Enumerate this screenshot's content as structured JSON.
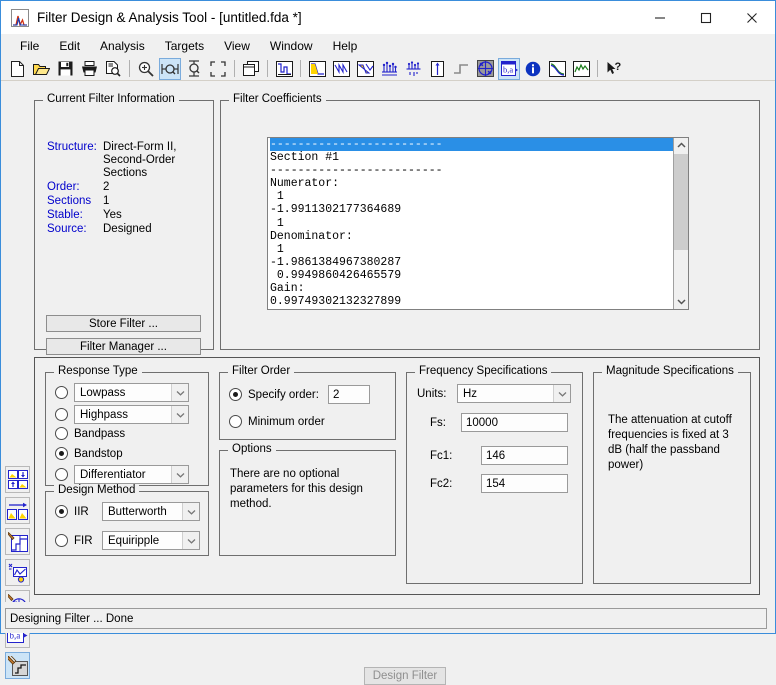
{
  "window": {
    "title": "Filter Design & Analysis Tool -  [untitled.fda *]",
    "app_icon": "filter-response-icon",
    "minimize": "minimize-icon",
    "maximize": "maximize-icon",
    "close": "close-icon"
  },
  "menu": {
    "items": [
      {
        "label": "File"
      },
      {
        "label": "Edit"
      },
      {
        "label": "Analysis"
      },
      {
        "label": "Targets"
      },
      {
        "label": "View"
      },
      {
        "label": "Window"
      },
      {
        "label": "Help"
      }
    ]
  },
  "toolbar": {
    "buttons": [
      {
        "name": "new-filter-icon",
        "selected": false
      },
      {
        "name": "open-session-icon",
        "selected": false
      },
      {
        "name": "save-session-icon",
        "selected": false
      },
      {
        "name": "print-icon",
        "selected": false
      },
      {
        "name": "print-preview-icon",
        "selected": false
      },
      {
        "name": "zoom-in-icon",
        "selected": false
      },
      {
        "name": "zoom-x-icon",
        "selected": true
      },
      {
        "name": "zoom-y-icon",
        "selected": false
      },
      {
        "name": "full-view-icon",
        "selected": false
      },
      {
        "name": "new-window-icon",
        "selected": false
      },
      {
        "name": "filter-specifications-icon",
        "selected": false
      },
      {
        "name": "magnitude-response-icon",
        "selected": false
      },
      {
        "name": "phase-response-icon",
        "selected": false
      },
      {
        "name": "magnitude-phase-icon",
        "selected": false
      },
      {
        "name": "group-delay-icon",
        "selected": false
      },
      {
        "name": "phase-delay-icon",
        "selected": false
      },
      {
        "name": "impulse-response-icon",
        "selected": false
      },
      {
        "name": "step-response-icon",
        "selected": false
      },
      {
        "name": "pole-zero-plot-icon",
        "selected": false
      },
      {
        "name": "filter-coefficients-icon",
        "selected": true
      },
      {
        "name": "filter-information-icon",
        "selected": false
      },
      {
        "name": "magnitude-estimate-icon",
        "selected": false
      },
      {
        "name": "round-off-noise-icon",
        "selected": false
      },
      {
        "name": "context-help-icon",
        "selected": false
      }
    ]
  },
  "sidebar": {
    "buttons": [
      {
        "name": "design-filter-side-icon",
        "selected": false
      },
      {
        "name": "import-filter-side-icon",
        "selected": false
      },
      {
        "name": "quantize-filter-side-icon",
        "selected": false
      },
      {
        "name": "transform-filter-side-icon",
        "selected": false
      },
      {
        "name": "pole-zero-editor-side-icon",
        "selected": false
      },
      {
        "name": "realize-model-side-icon",
        "selected": false
      },
      {
        "name": "set-quantization-side-icon",
        "selected": true
      }
    ]
  },
  "current_filter_information": {
    "legend": "Current Filter Information",
    "rows": [
      {
        "key": "Structure:",
        "value": [
          "Direct-Form II,",
          "Second-Order",
          "Sections"
        ]
      },
      {
        "key": "Order:",
        "value": [
          "2"
        ]
      },
      {
        "key": "Sections",
        "value": [
          "1"
        ]
      },
      {
        "key": "Stable:",
        "value": [
          "Yes"
        ]
      },
      {
        "key": "Source:",
        "value": [
          "Designed"
        ]
      }
    ],
    "store_filter_button": "Store Filter ...",
    "filter_manager_button": "Filter Manager ..."
  },
  "filter_coefficients": {
    "legend": "Filter Coefficients",
    "highlighted_line": "-------------------------",
    "lines": [
      "Section #1",
      "-------------------------",
      "Numerator:",
      " 1",
      "-1.9911302177364689",
      " 1",
      "Denominator:",
      " 1",
      "-1.9861384967380287",
      " 0.9949860426465579",
      "Gain:",
      "0.99749302132327899"
    ],
    "scroll_up_icon": "chevron-up-icon",
    "scroll_down_icon": "chevron-down-icon"
  },
  "response_type": {
    "legend": "Response Type",
    "options": [
      {
        "label": "Lowpass",
        "selected": false,
        "has_combo": true,
        "combo_value": "Lowpass"
      },
      {
        "label": "Highpass",
        "selected": false,
        "has_combo": true,
        "combo_value": "Highpass"
      },
      {
        "label": "Bandpass",
        "selected": false,
        "has_combo": false
      },
      {
        "label": "Bandstop",
        "selected": true,
        "has_combo": false
      },
      {
        "label": "Differentiator",
        "selected": false,
        "has_combo": true,
        "combo_value": "Differentiator"
      }
    ]
  },
  "design_method": {
    "legend": "Design Method",
    "options": [
      {
        "label": "IIR",
        "selected": true,
        "combo_value": "Butterworth"
      },
      {
        "label": "FIR",
        "selected": false,
        "combo_value": "Equiripple"
      }
    ]
  },
  "filter_order": {
    "legend": "Filter Order",
    "specify_label": "Specify order:",
    "specify_selected": true,
    "order_value": "2",
    "minimum_label": "Minimum order",
    "minimum_selected": false
  },
  "options": {
    "legend": "Options",
    "text": "There are no optional parameters for this design method."
  },
  "frequency_specifications": {
    "legend": "Frequency Specifications",
    "units_label": "Units:",
    "units_value": "Hz",
    "fields": [
      {
        "label": "Fs:",
        "value": "10000"
      },
      {
        "label": "Fc1:",
        "value": "146"
      },
      {
        "label": "Fc2:",
        "value": "154"
      }
    ]
  },
  "magnitude_specifications": {
    "legend": "Magnitude Specifications",
    "text": "The attenuation at cutoff frequencies is fixed at 3 dB (half the passband power)"
  },
  "design_filter_button": {
    "label": "Design Filter",
    "enabled": false
  },
  "status_bar": {
    "text": "Designing Filter ... Done"
  },
  "colors": {
    "window_face": "#f0f0f0",
    "label_blue": "#0000cc",
    "selection_blue": "#2a8fe6",
    "icon_blue": "#2222cc",
    "icon_yellow": "#ffdd22",
    "accent_border": "#3a8ddb"
  }
}
